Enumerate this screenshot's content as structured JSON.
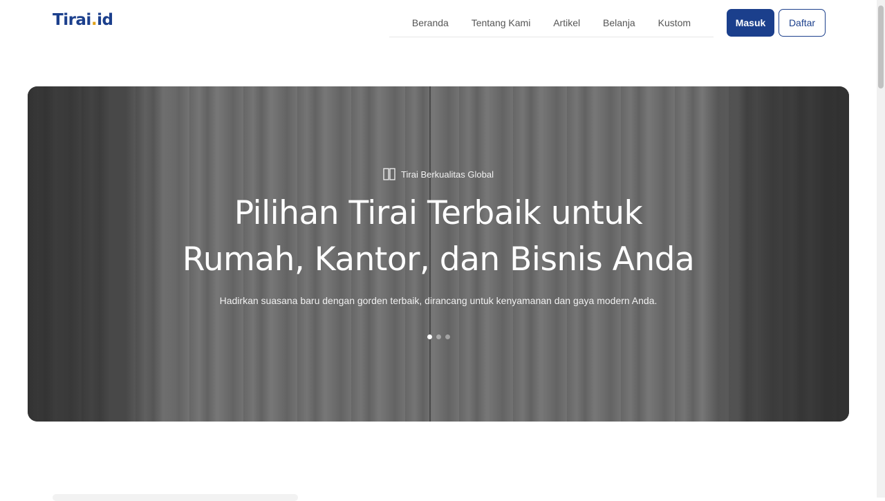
{
  "logo": {
    "main": "Tirai",
    "dot": ".",
    "suffix": "id"
  },
  "nav": {
    "items": [
      "Beranda",
      "Tentang Kami",
      "Artikel",
      "Belanja",
      "Kustom"
    ]
  },
  "auth": {
    "login": "Masuk",
    "register": "Daftar"
  },
  "hero": {
    "tagline": "Tirai Berkualitas Global",
    "title_line1": "Pilihan Tirai Terbaik untuk",
    "title_line2": "Rumah, Kantor, dan Bisnis Anda",
    "subtitle": "Hadirkan suasana baru dengan gorden terbaik, dirancang untuk kenyamanan dan gaya modern Anda.",
    "slide_count": 3,
    "active_slide": 1
  },
  "colors": {
    "brand": "#1b3f8c",
    "accent": "#e0a21b"
  }
}
